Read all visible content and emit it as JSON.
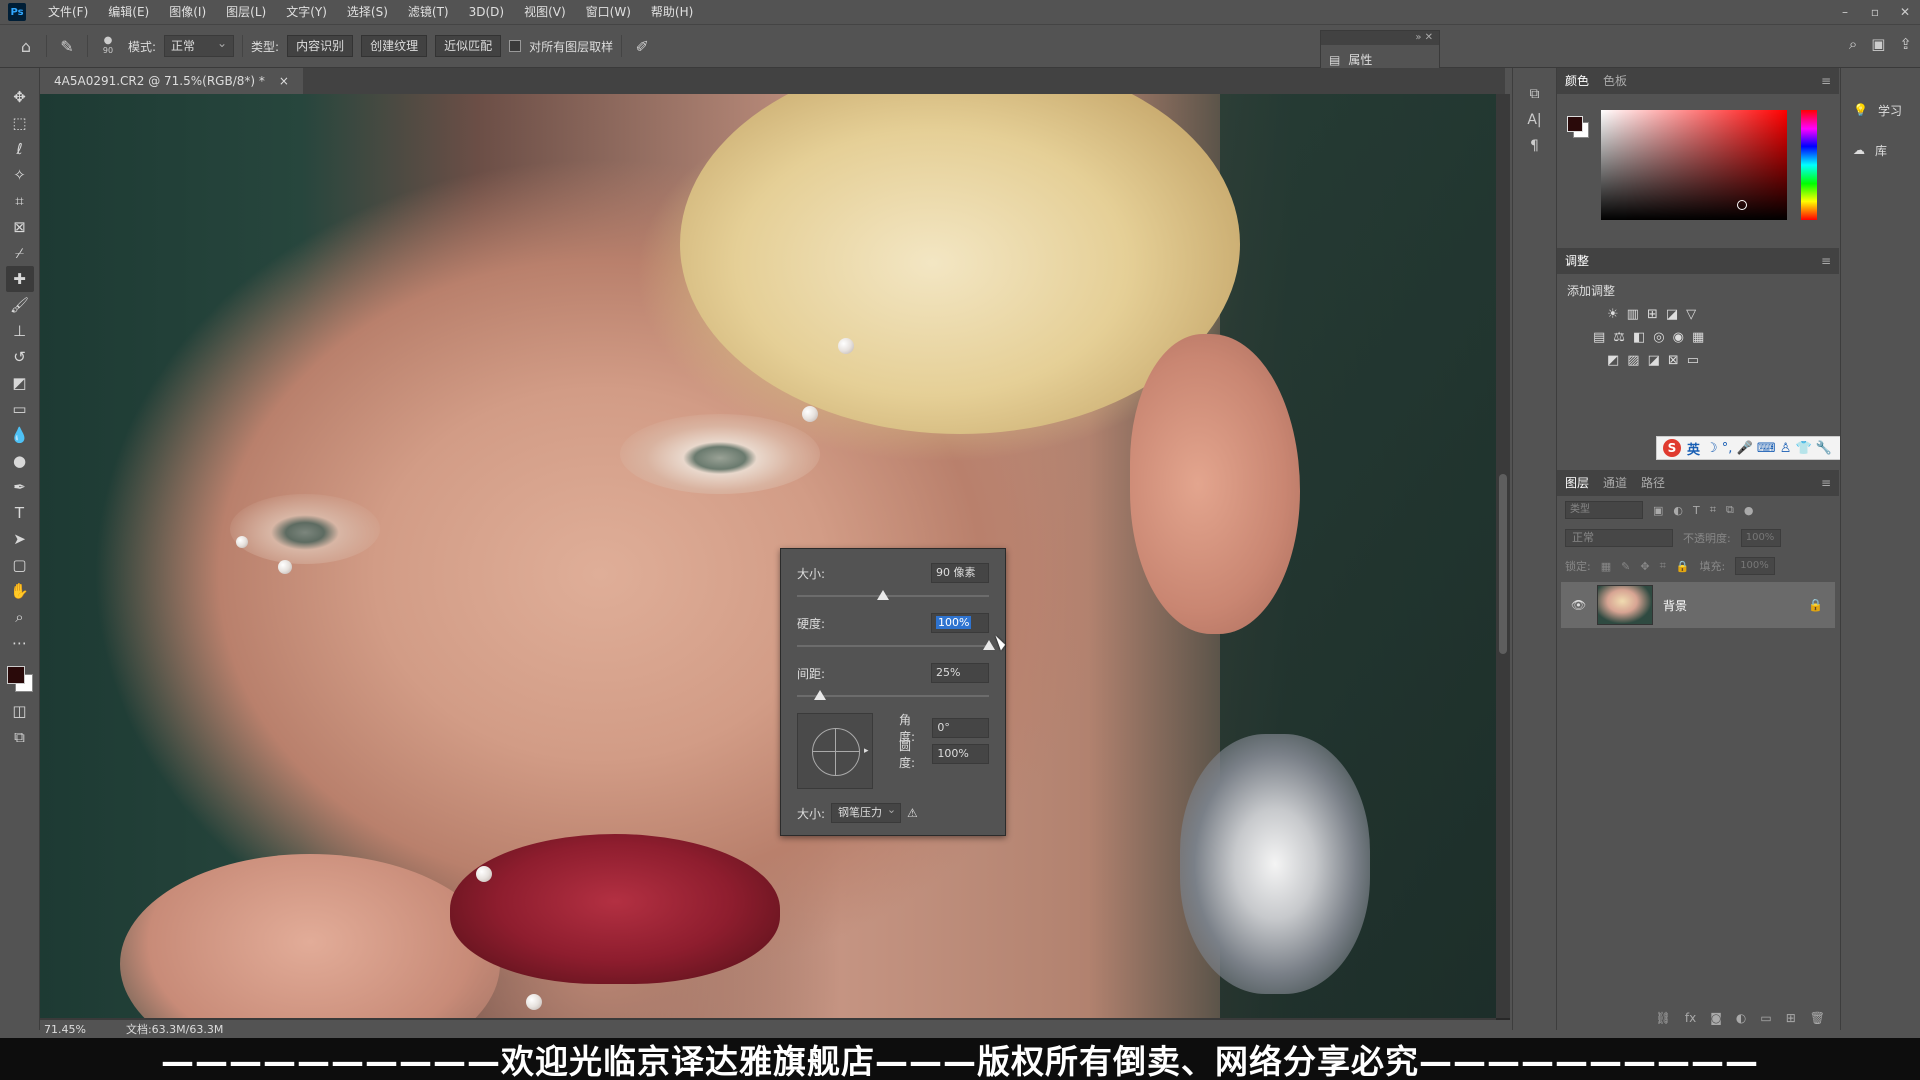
{
  "menubar": {
    "logo": "Ps",
    "items": [
      "文件(F)",
      "编辑(E)",
      "图像(I)",
      "图层(L)",
      "文字(Y)",
      "选择(S)",
      "滤镜(T)",
      "3D(D)",
      "视图(V)",
      "窗口(W)",
      "帮助(H)"
    ],
    "window_controls": [
      "–",
      "▫",
      "✕"
    ]
  },
  "options": {
    "brush_size_badge": "90",
    "mode_label": "模式:",
    "mode_value": "正常",
    "type_label": "类型:",
    "btn_content_aware": "内容识别",
    "btn_create_texture": "创建纹理",
    "btn_proximity_match": "近似匹配",
    "sample_all_layers": "对所有图层取样"
  },
  "document": {
    "tab_title": "4A5A0291.CR2 @ 71.5%(RGB/8*) *",
    "tab_close": "×",
    "zoom": "71.45%",
    "doc_size": "文档:63.3M/63.3M"
  },
  "brush_popup": {
    "size_label": "大小:",
    "size_value": "90 像素",
    "hardness_label": "硬度:",
    "hardness_value": "100%",
    "spacing_label": "间距:",
    "spacing_value": "25%",
    "angle_label": "角度:",
    "angle_value": "0°",
    "roundness_label": "圆度:",
    "roundness_value": "100%",
    "pen_size_label": "大小:",
    "pen_pressure_value": "钢笔压力",
    "size_slider_fraction": 0.45,
    "hardness_slider_fraction": 1.0,
    "spacing_slider_fraction": 0.12
  },
  "properties": {
    "title": "属性",
    "collapse": "»  ✕"
  },
  "color_panel": {
    "tabs": [
      "颜色",
      "色板"
    ],
    "menu": "≡",
    "foreground": "#2a0a0a",
    "background": "#ffffff"
  },
  "adjustments": {
    "tab": "调整",
    "menu": "≡",
    "title": "添加调整"
  },
  "ime": {
    "badge": "S",
    "lang": "英",
    "icons": "☽ °, 🎤 ⌨ ♙ 👕 🔧"
  },
  "layers": {
    "tabs": [
      "图层",
      "通道",
      "路径"
    ],
    "menu": "≡",
    "filter_placeholder": "类型",
    "blend_mode": "正常",
    "opacity_label": "不透明度:",
    "opacity_value": "100%",
    "lock_label": "锁定:",
    "fill_label": "填充:",
    "fill_value": "100%",
    "layer_name": "背景"
  },
  "far_panel": {
    "learn": "学习",
    "libraries": "库"
  },
  "banner": {
    "text": "——————————欢迎光临京译达雅旗舰店———版权所有倒卖、网络分享必究——————————"
  },
  "colors": {
    "ui_dark": "#535353",
    "accent_selection": "#2f74d0",
    "lip_red": "#8e1d2e"
  }
}
